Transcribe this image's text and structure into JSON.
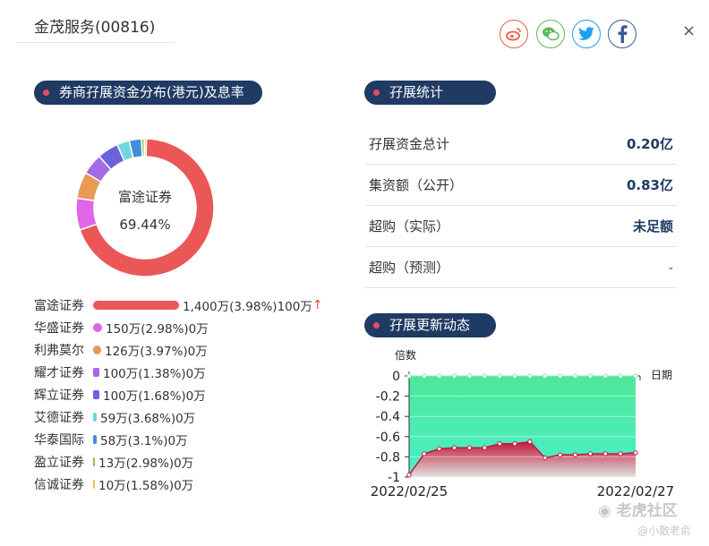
{
  "header": {
    "title": "金茂服务(00816)",
    "close_label": "×"
  },
  "social": [
    {
      "name": "weibo",
      "color": "#e8603c"
    },
    {
      "name": "wechat",
      "color": "#5cb85c"
    },
    {
      "name": "twitter",
      "color": "#1da1f2"
    },
    {
      "name": "facebook",
      "color": "#3b5998"
    }
  ],
  "left_section": {
    "title": "券商孖展资金分布(港元)及息率"
  },
  "donut": {
    "center_name": "富途证券",
    "center_pct": "69.44%",
    "slices": [
      {
        "color": "#eb5657",
        "value": 1400
      },
      {
        "color": "#e165e8",
        "value": 150
      },
      {
        "color": "#e89b55",
        "value": 126
      },
      {
        "color": "#a56ae6",
        "value": 100
      },
      {
        "color": "#6b63dd",
        "value": 100
      },
      {
        "color": "#6fd6e0",
        "value": 59
      },
      {
        "color": "#3f8fdc",
        "value": 58
      },
      {
        "color": "#8bc34a",
        "value": 13
      },
      {
        "color": "#e8c84a",
        "value": 10
      }
    ]
  },
  "brokers": [
    {
      "name": "富途证券",
      "value": "1,400万(3.98%)100万",
      "arrow": "↑",
      "color": "#eb5657",
      "share": 1.0
    },
    {
      "name": "华盛证券",
      "value": "150万(2.98%)0万",
      "arrow": "",
      "color": "#e165e8",
      "share": 0.107
    },
    {
      "name": "利弗莫尔",
      "value": "126万(3.97%)0万",
      "arrow": "",
      "color": "#e89b55",
      "share": 0.09
    },
    {
      "name": "耀才证券",
      "value": "100万(1.38%)0万",
      "arrow": "",
      "color": "#a56ae6",
      "share": 0.071
    },
    {
      "name": "辉立证券",
      "value": "100万(1.68%)0万",
      "arrow": "",
      "color": "#6b63dd",
      "share": 0.071
    },
    {
      "name": "艾德证券",
      "value": "59万(3.68%)0万",
      "arrow": "",
      "color": "#6fd6e0",
      "share": 0.042
    },
    {
      "name": "华泰国际",
      "value": "58万(3.1%)0万",
      "arrow": "",
      "color": "#3f8fdc",
      "share": 0.041
    },
    {
      "name": "盈立证券",
      "value": "13万(2.98%)0万",
      "arrow": "",
      "color": "#8bc34a",
      "share": 0.009
    },
    {
      "name": "信诚证券",
      "value": "10万(1.58%)0万",
      "arrow": "",
      "color": "#e8c84a",
      "share": 0.007
    }
  ],
  "stats_section": {
    "title": "孖展统计"
  },
  "stats": [
    {
      "label": "孖展资金总计",
      "value": "0.20亿"
    },
    {
      "label": "集资额（公开）",
      "value": "0.83亿"
    },
    {
      "label": "超购（实际）",
      "value": "未足额"
    },
    {
      "label": "超购（预测）",
      "value": "-"
    }
  ],
  "trend_section": {
    "title": "孖展更新动态"
  },
  "chart_data": {
    "type": "area",
    "ylabel": "倍数",
    "xlabel": "日期",
    "ylim": [
      -1.0,
      0
    ],
    "yticks": [
      "0",
      "-0.2",
      "-0.4",
      "-0.6",
      "-0.8",
      "-1"
    ],
    "x_tick_labels": [
      "2022/02/25",
      "2022/02/27"
    ],
    "series": [
      {
        "values": [
          -0.98,
          -0.77,
          -0.72,
          -0.71,
          -0.71,
          -0.71,
          -0.67,
          -0.67,
          -0.65,
          -0.81,
          -0.78,
          -0.78,
          -0.77,
          -0.77,
          -0.77,
          -0.76
        ]
      },
      {
        "values": [
          0,
          0,
          0,
          0,
          0,
          0,
          0,
          0,
          0,
          0,
          0,
          0,
          0,
          0,
          0,
          0
        ]
      }
    ],
    "colors": {
      "upper_fill": "#4ee89a",
      "lower_fill": "#c2183a",
      "line": "#c2183a"
    }
  },
  "watermark": {
    "brand": "老虎社区",
    "user": "@小散老俞"
  }
}
